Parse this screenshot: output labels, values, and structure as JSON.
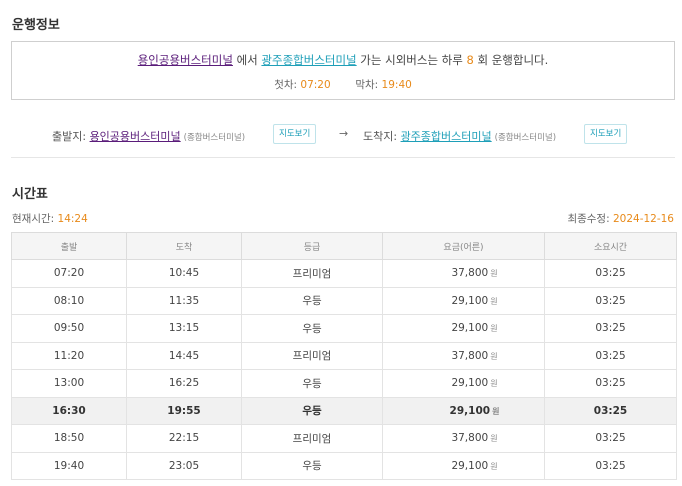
{
  "section1_title": "운행정보",
  "info": {
    "origin": "용인공용버스터미널",
    "mid1": " 에서 ",
    "destination": "광주종합버스터미널",
    "mid2": " 가는 시외버스는 하루 ",
    "count": "8",
    "mid3": " 회 운행합니다.",
    "first_label": "첫차: ",
    "first_time": "07:20",
    "last_label": "막차: ",
    "last_time": "19:40"
  },
  "route": {
    "from_label": "출발지: ",
    "from_name": "용인공용버스터미널",
    "from_type": "(종합버스터미널)",
    "to_label": "도착지: ",
    "to_name": "광주종합버스터미널",
    "to_type": "(종합버스터미널)",
    "map_button": "지도보기",
    "arrow": "→"
  },
  "section2_title": "시간표",
  "current_time_label": "현재시간: ",
  "current_time": "14:24",
  "updated_label": "최종수정: ",
  "updated_date": "2024-12-16",
  "colors": {
    "accent": "#e88a1a",
    "link_teal": "#1e9fb8",
    "link_purple": "#5a1c7a"
  },
  "table": {
    "headers": [
      "출발",
      "도착",
      "등급",
      "요금(어른)",
      "소요시간"
    ],
    "currency": "원",
    "rows": [
      {
        "dep": "07:20",
        "arr": "10:45",
        "grade": "프리미엄",
        "fare": "37,800",
        "dur": "03:25"
      },
      {
        "dep": "08:10",
        "arr": "11:35",
        "grade": "우등",
        "fare": "29,100",
        "dur": "03:25"
      },
      {
        "dep": "09:50",
        "arr": "13:15",
        "grade": "우등",
        "fare": "29,100",
        "dur": "03:25"
      },
      {
        "dep": "11:20",
        "arr": "14:45",
        "grade": "프리미엄",
        "fare": "37,800",
        "dur": "03:25"
      },
      {
        "dep": "13:00",
        "arr": "16:25",
        "grade": "우등",
        "fare": "29,100",
        "dur": "03:25"
      },
      {
        "dep": "16:30",
        "arr": "19:55",
        "grade": "우등",
        "fare": "29,100",
        "dur": "03:25",
        "highlight": true
      },
      {
        "dep": "18:50",
        "arr": "22:15",
        "grade": "프리미엄",
        "fare": "37,800",
        "dur": "03:25"
      },
      {
        "dep": "19:40",
        "arr": "23:05",
        "grade": "우등",
        "fare": "29,100",
        "dur": "03:25"
      }
    ]
  }
}
